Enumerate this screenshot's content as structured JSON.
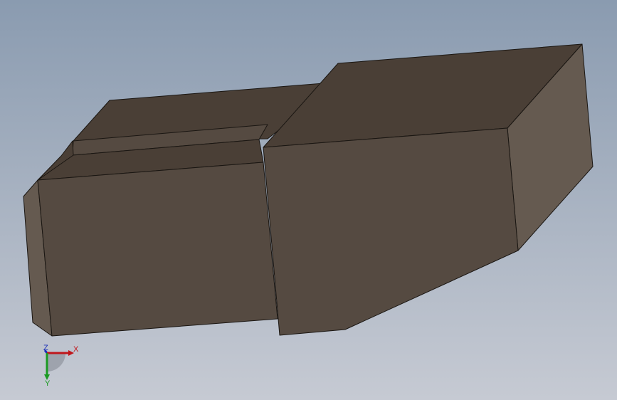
{
  "viewport": {
    "background": {
      "top_color": "#8a9bb0",
      "bottom_color": "#c6cad3"
    }
  },
  "model": {
    "face_colors": {
      "top": "#4a3f36",
      "front": "#554a41",
      "side": "#655a50",
      "edge": "#1a1612"
    }
  },
  "triad": {
    "x_label": "X",
    "y_label": "Y",
    "z_label": "Z",
    "x_color": "#c0161b",
    "y_color": "#1a9a22",
    "z_color": "#1b2fb8"
  }
}
